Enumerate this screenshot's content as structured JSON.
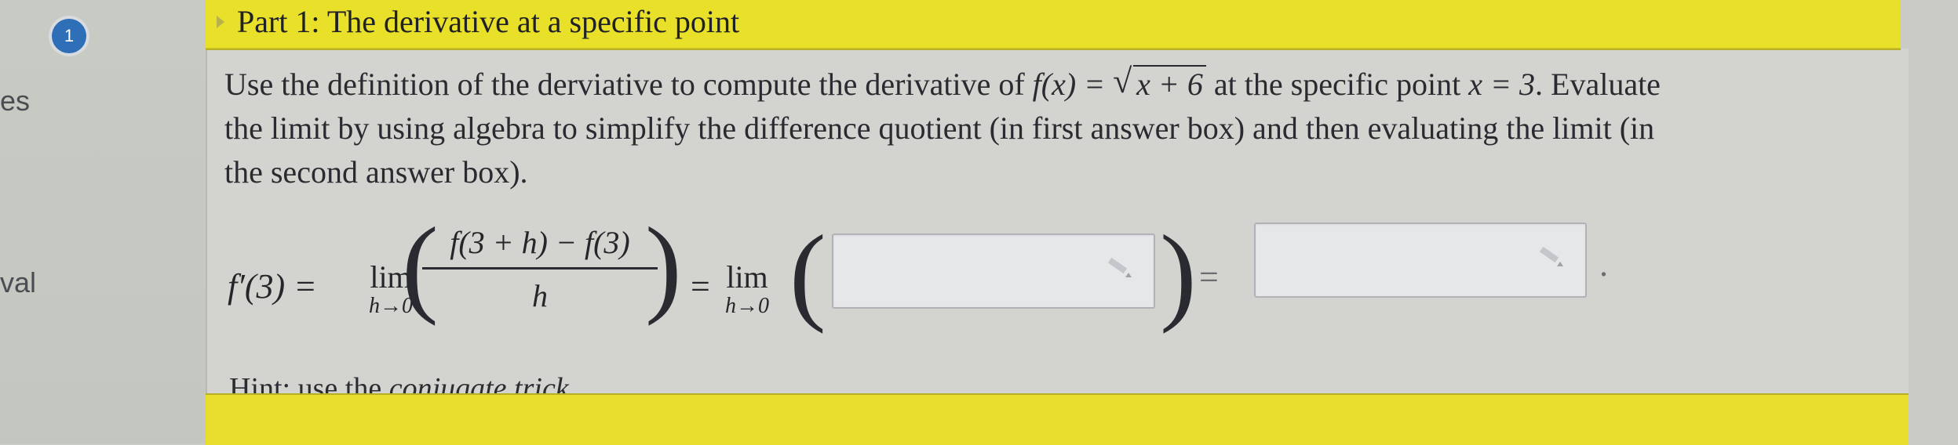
{
  "sidebar": {
    "items": [
      {
        "label": "es"
      },
      {
        "label": "val"
      }
    ],
    "badge": "1"
  },
  "part": {
    "title": "Part 1: The derivative at a specific point"
  },
  "prompt": {
    "line1_a": "Use the definition of the derviative to compute the derivative of ",
    "func": "f(x) =",
    "radicand": "x + 6",
    "line1_b": " at the specific point ",
    "point": "x = 3",
    "line1_c": ". Evaluate",
    "line2": "the limit by using algebra to simplify the difference quotient (in first answer box) and then evaluating the limit (in",
    "line3": "the second answer box)."
  },
  "equation": {
    "lhs": "f′(3) =",
    "lim_word": "lim",
    "lim_sub": "h→0",
    "numerator": "f(3 + h) − f(3)",
    "denominator": "h",
    "equals": "=",
    "period": "."
  },
  "answers": [
    {
      "value": "",
      "placeholder": ""
    },
    {
      "value": "",
      "placeholder": ""
    }
  ],
  "hint": {
    "prefix": "Hint: use the ",
    "emph": "conjugate trick."
  },
  "colors": {
    "header_yellow": "#e9e02a",
    "badge_blue": "#2f6fb8"
  }
}
